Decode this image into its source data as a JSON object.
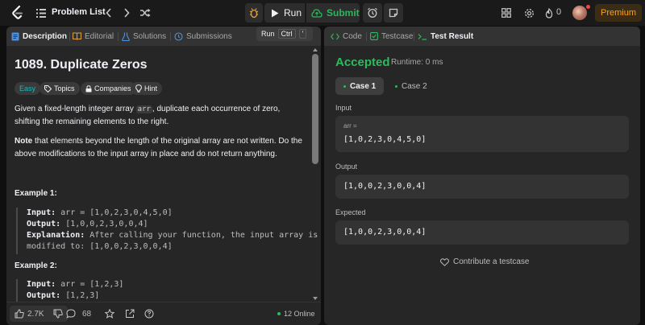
{
  "topbar": {
    "problem_list_label": "Problem List",
    "run_label": "Run",
    "submit_label": "Submit",
    "streak_count": "0",
    "premium_label": "Premium"
  },
  "tooltip": {
    "label": "Run",
    "key1": "Ctrl",
    "key2": "'"
  },
  "left_panel": {
    "tabs": [
      {
        "label": "Description"
      },
      {
        "label": "Editorial"
      },
      {
        "label": "Solutions"
      },
      {
        "label": "Submissions"
      }
    ],
    "title": "1089. Duplicate Zeros",
    "tags": [
      {
        "label": "Easy"
      },
      {
        "label": "Topics"
      },
      {
        "label": "Companies"
      },
      {
        "label": "Hint"
      }
    ],
    "description": {
      "p1_a": "Given a fixed-length integer array ",
      "p1_code": "arr",
      "p1_b": ", duplicate each occurrence of zero, shifting the remaining elements to the right.",
      "p2_bold": "Note",
      "p2_rest": " that elements beyond the length of the original array are not written. Do the above modifications to the input array in place and do not return anything."
    },
    "examples": [
      {
        "title": "Example 1:",
        "input_label": "Input:",
        "input": "arr = [1,0,2,3,0,4,5,0]",
        "output_label": "Output:",
        "output": "[1,0,0,2,3,0,0,4]",
        "explanation_label": "Explanation:",
        "explanation_line1": "After calling your function, the input array is",
        "explanation_line2": "modified to: [1,0,0,2,3,0,0,4]"
      },
      {
        "title": "Example 2:",
        "input_label": "Input:",
        "input": "arr = [1,2,3]",
        "output_label": "Output:",
        "output": "[1,2,3]"
      }
    ],
    "footer": {
      "likes": "2.7K",
      "comments": "68",
      "online": "12 Online"
    }
  },
  "right_panel": {
    "tabs": [
      {
        "label": "Code"
      },
      {
        "label": "Testcase"
      },
      {
        "label": "Test Result"
      }
    ],
    "status": "Accepted",
    "runtime": "Runtime: 0 ms",
    "cases": [
      {
        "label": "Case 1"
      },
      {
        "label": "Case 2"
      }
    ],
    "input_label": "Input",
    "input_var": "arr =",
    "input_value": "[1,0,2,3,0,4,5,0]",
    "output_label": "Output",
    "output_value": "[1,0,0,2,3,0,0,4]",
    "expected_label": "Expected",
    "expected_value": "[1,0,0,2,3,0,0,4]",
    "contribute_label": "Contribute a testcase"
  },
  "colors": {
    "accepted": "#2cbb5d",
    "easy": "#1cb8b8",
    "premium": "#ffa116",
    "online_dot": "#2cbb5d"
  }
}
